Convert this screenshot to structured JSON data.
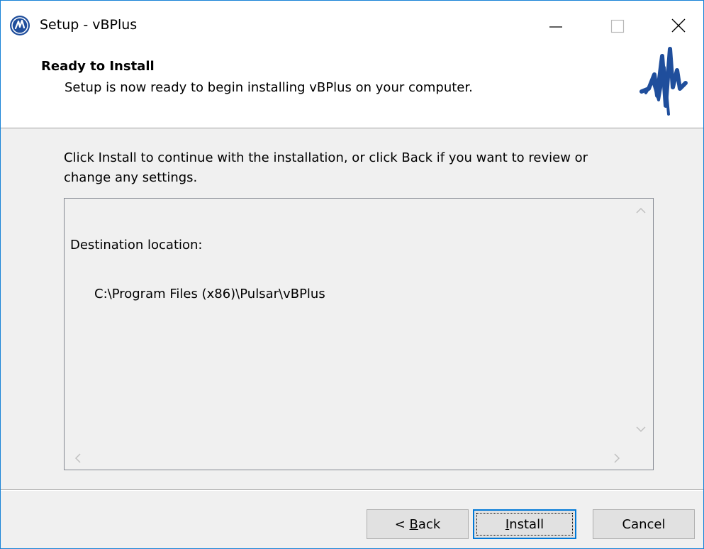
{
  "window": {
    "title": "Setup - vBPlus",
    "accent_color": "#1883d7",
    "icons": [
      "app-icon",
      "minimize-icon",
      "maximize-icon",
      "close-icon"
    ]
  },
  "header": {
    "title": "Ready to Install",
    "subtitle": "Setup is now ready to begin installing vBPlus on your computer.",
    "logo_icon": "pulsar-waveform-logo",
    "logo_color": "#1f4e9c"
  },
  "body": {
    "instruction": "Click Install to continue with the installation, or click Back if you want to review or change any settings.",
    "memo": {
      "line1": "Destination location:",
      "line2": "C:\\Program Files (x86)\\Pulsar\\vBPlus"
    }
  },
  "buttons": {
    "back_prefix": "< ",
    "back_mnemonic": "B",
    "back_rest": "ack",
    "install_mnemonic": "I",
    "install_rest": "nstall",
    "cancel": "Cancel"
  }
}
